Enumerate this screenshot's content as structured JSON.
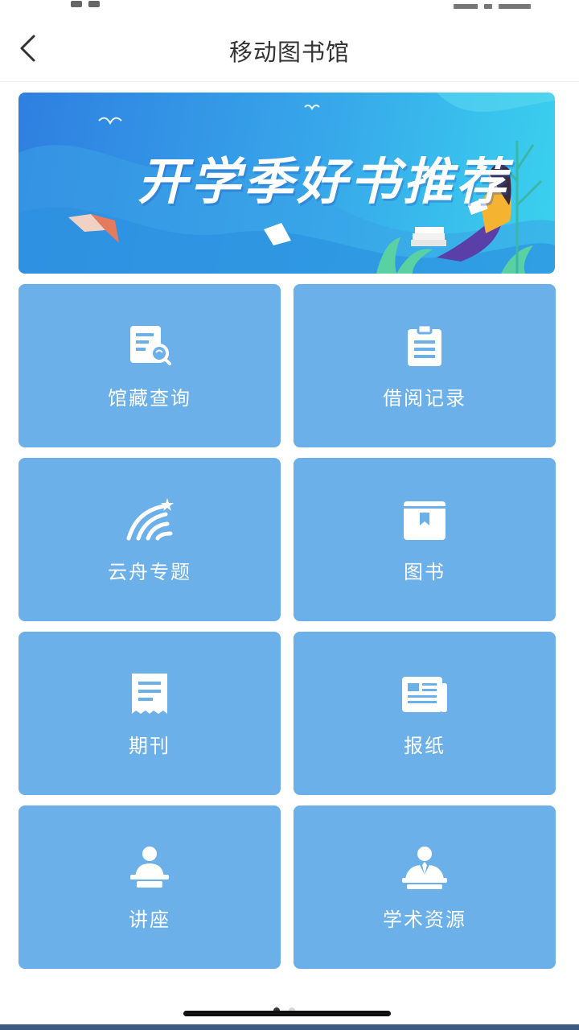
{
  "nav": {
    "title": "移动图书馆",
    "back_icon": "chevron-left-icon"
  },
  "banner": {
    "headline": "开学季好书推荐"
  },
  "tiles": [
    {
      "label": "馆藏查询",
      "icon": "catalog-search-icon"
    },
    {
      "label": "借阅记录",
      "icon": "clipboard-icon"
    },
    {
      "label": "云舟专题",
      "icon": "comet-arc-icon"
    },
    {
      "label": "图书",
      "icon": "book-icon"
    },
    {
      "label": "期刊",
      "icon": "journal-icon"
    },
    {
      "label": "报纸",
      "icon": "newspaper-icon"
    },
    {
      "label": "讲座",
      "icon": "lecture-icon"
    },
    {
      "label": "学术资源",
      "icon": "academic-resource-icon"
    }
  ],
  "pager": {
    "current": 1,
    "total": 2
  },
  "colors": {
    "tile": "#6cb0ea",
    "tile_text": "#ffffff",
    "nav_text": "#333333",
    "banner_start": "#2f7fe0",
    "banner_end": "#3ad2ee"
  }
}
